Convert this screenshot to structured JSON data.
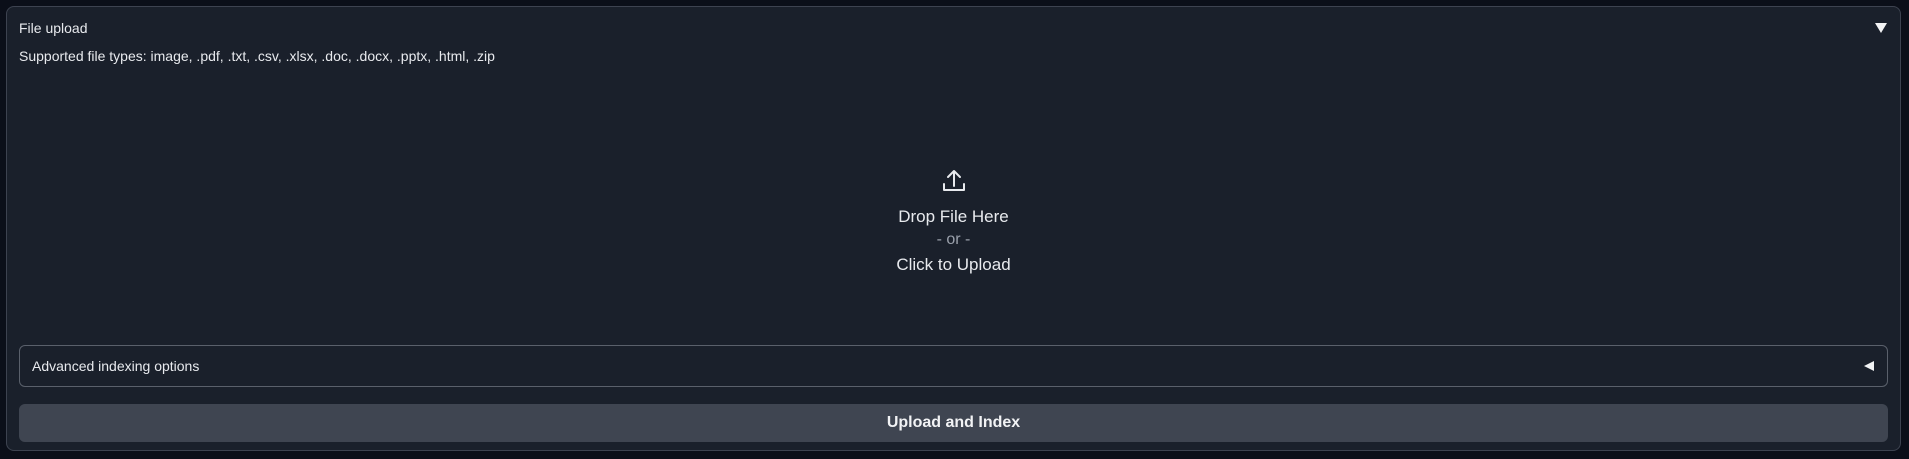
{
  "panel": {
    "title": "File upload",
    "collapse_icon": "triangle-down-icon"
  },
  "supported_types": "Supported file types: image, .pdf, .txt, .csv, .xlsx, .doc, .docx, .pptx, .html, .zip",
  "dropzone": {
    "icon": "upload-icon",
    "drop_label": "Drop File Here",
    "or_label": "- or -",
    "click_label": "Click to Upload"
  },
  "advanced": {
    "label": "Advanced indexing options",
    "expand_icon": "triangle-left-icon"
  },
  "upload_button": {
    "label": "Upload and Index"
  },
  "colors": {
    "background": "#0b0f19",
    "panel": "#1a202b",
    "border": "#3d4350",
    "button": "#3f4551",
    "text": "#e8eaee",
    "muted_text": "#9aa0ab"
  }
}
